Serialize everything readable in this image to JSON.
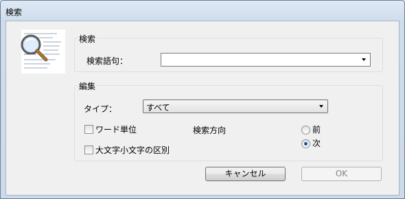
{
  "window": {
    "title": "検索"
  },
  "search_group": {
    "label": "検索",
    "term_label": "検索語句：",
    "term_value": ""
  },
  "edit_group": {
    "label": "編集",
    "type_label": "タイプ：",
    "type_value": "すべて",
    "whole_word_label": "ワード単位",
    "match_case_label": "大文字小文字の区別",
    "direction_label": "検索方向",
    "dir_prev_label": "前",
    "dir_next_label": "次",
    "whole_word_checked": false,
    "match_case_checked": false,
    "direction_selected": "次"
  },
  "buttons": {
    "cancel": "キャンセル",
    "ok": "OK"
  },
  "icons": {
    "header_art": "magnifier-over-document-icon"
  }
}
